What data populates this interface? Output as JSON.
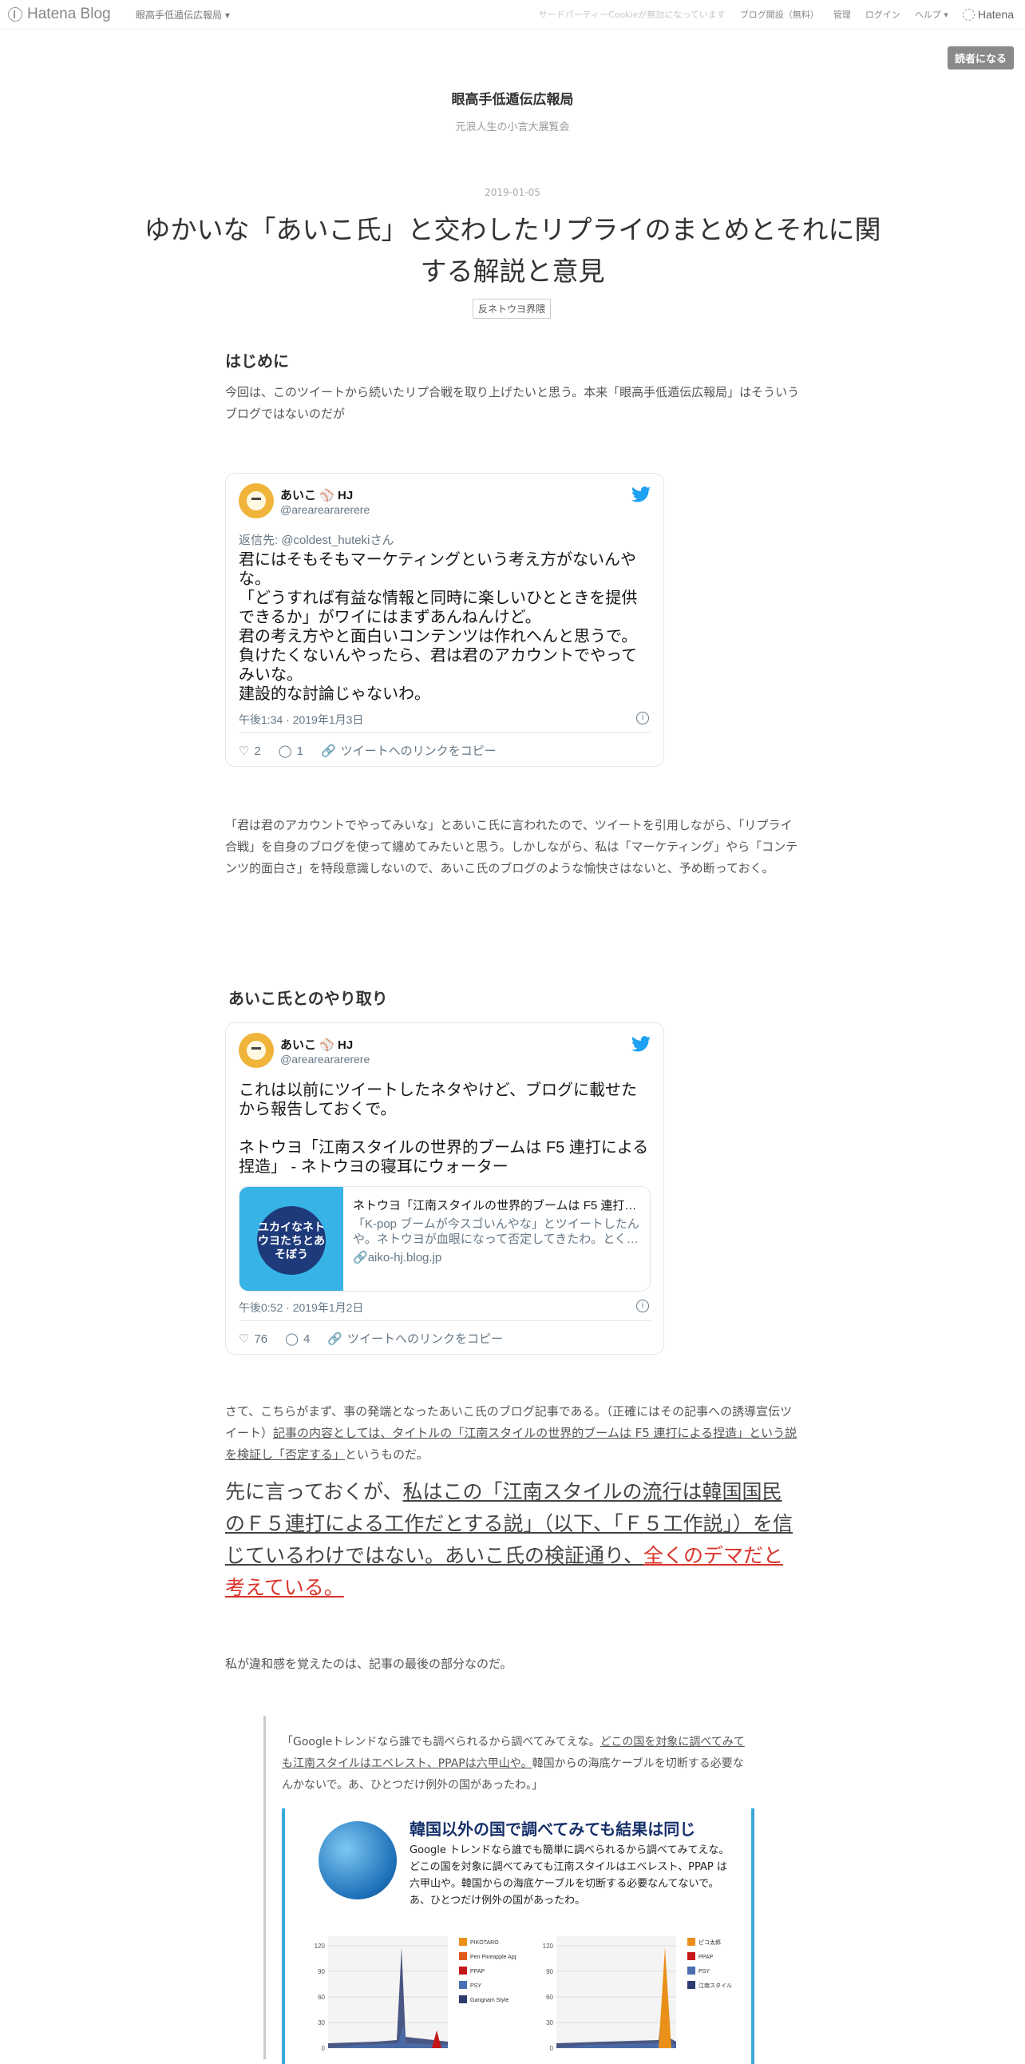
{
  "header": {
    "logo": "Hatena Blog",
    "blog_menu": "眼高手低遁伝広報局",
    "cookie_notice": "サードパーティーCookieが無効になっています",
    "open_blog": "ブログ開設（無料）",
    "admin": "管理",
    "login": "ログイン",
    "help": "ヘルプ",
    "hatena": "Hatena",
    "reader_button": "読者になる"
  },
  "blog": {
    "title": "眼高手低遁伝広報局",
    "description": "元浪人生の小言大展覧会"
  },
  "entry": {
    "date": "2019-01-05",
    "title": "ゆかいな「あいこ氏」と交わしたリプライのまとめとそれに関する解説と意見",
    "category": "反ネトウヨ界隈"
  },
  "section1": {
    "heading": "はじめに",
    "intro": "今回は、このツイートから続いたリプ合戦を取り上げたいと思う。本来「眼高手低遁伝広報局」はそういうブログではないのだが"
  },
  "tweet1": {
    "name": "あいこ",
    "badge": "⚾",
    "name_suffix": "HJ",
    "handle": "@areareararerere",
    "reply_to": "返信先: @coldest_hutekiさん",
    "text": "君にはそもそもマーケティングという考え方がないんやな。\n「どうすれば有益な情報と同時に楽しいひとときを提供できるか」がワイにはまずあんねんけど。\n君の考え方やと面白いコンテンツは作れへんと思うで。\n負けたくないんやったら、君は君のアカウントでやってみいな。\n建設的な討論じゃないわ。",
    "time": "午後1:34 · 2019年1月3日",
    "likes": "2",
    "replies": "1",
    "copy_link": "ツイートへのリンクをコピー"
  },
  "para2": "「君は君のアカウントでやってみいな」とあいこ氏に言われたので、ツイートを引用しながら、「リプライ合戦」を自身のブログを使って纏めてみたいと思う。しかしながら、私は「マーケティング」やら「コンテンツ的面白さ」を特段意識しないので、あいこ氏のブログのような愉快さはないと、予め断っておく。",
  "section2": {
    "heading": "あいこ氏とのやり取り"
  },
  "tweet2": {
    "name": "あいこ",
    "badge": "⚾",
    "name_suffix": "HJ",
    "handle": "@areareararerere",
    "text": "これは以前にツイートしたネタやけど、ブログに載せたから報告しておくで。\n\nネトウヨ「江南スタイルの世界的ブームは F5 連打による捏造」 - ネトウヨの寝耳にウォーター",
    "card_thumb": "ユカイなネトウヨたちとあそぼう",
    "card_title": "ネトウヨ「江南スタイルの世界的ブームは F5 連打…",
    "card_desc": "「K-pop ブームが今スゴいんやな」とツイートしたんや。ネトウヨが血眼になって否定してきたわ。とく…",
    "card_url": "aiko-hj.blog.jp",
    "time": "午後0:52 · 2019年1月2日",
    "likes": "76",
    "replies": "4",
    "copy_link": "ツイートへのリンクをコピー"
  },
  "para3": {
    "a": "さて、こちらがまず、事の発端となったあいこ氏のブログ記事である。（正確にはその記事への誘導宣伝ツイート）",
    "b": "記事の内容としては、タイトルの「江南スタイルの世界的ブームは F5 連打による捏造」という説を検証し「否定する」",
    "c": "というものだ。"
  },
  "big": {
    "a": "先に言っておくが、",
    "b": "私はこの「江南スタイルの流行は韓国国民のＦ５連打による工作だとする説」（以下、「Ｆ５工作説」）を信じているわけではない。あいこ氏の検証通り、",
    "c": "全くのデマだと考えている。"
  },
  "para4": "私が違和感を覚えたのは、記事の最後の部分なのだ。",
  "quote": {
    "a": "「Googleトレンドなら誰でも調べられるから調べてみてえな。",
    "b": "どこの国を対象に調べてみても江南スタイルはエベレスト、PPAPは六甲山や。",
    "c": "韓国からの海底ケーブルを切断する必要なんかないで。あ、ひとつだけ例外の国があったわ。」",
    "img_title": "韓国以外の国で調べてみても結果は同じ",
    "img_desc": "Google トレンドなら誰でも簡単に調べられるから調べてみてえな。どこの国を対象に調べてみても江南スタイルはエベレスト、PPAP は六甲山や。韓国からの海底ケーブルを切断する必要なんてないで。あ、ひとつだけ例外の国があったわ。"
  },
  "chart_data": [
    {
      "type": "area",
      "title": "",
      "series": [
        {
          "name": "PIKOTARO",
          "color": "#e8901a"
        },
        {
          "name": "Pen Pineapple Apple Pen",
          "color": "#e05a1a"
        },
        {
          "name": "PPAP",
          "color": "#c41818"
        },
        {
          "name": "PSY",
          "color": "#4a6fb0"
        },
        {
          "name": "Gangnam Style",
          "color": "#2c3b6e"
        }
      ],
      "y_ticks": [
        "120",
        "90",
        "60",
        "30",
        "0"
      ],
      "ylim": [
        0,
        120
      ]
    },
    {
      "type": "area",
      "title": "",
      "series": [
        {
          "name": "ピコ太郎",
          "color": "#e8901a"
        },
        {
          "name": "PPAP",
          "color": "#c41818"
        },
        {
          "name": "PSY",
          "color": "#4a6fb0"
        },
        {
          "name": "江南スタイル",
          "color": "#2c3b6e"
        }
      ],
      "y_ticks": [
        "120",
        "90",
        "60",
        "30",
        "0"
      ],
      "ylim": [
        0,
        120
      ]
    }
  ]
}
